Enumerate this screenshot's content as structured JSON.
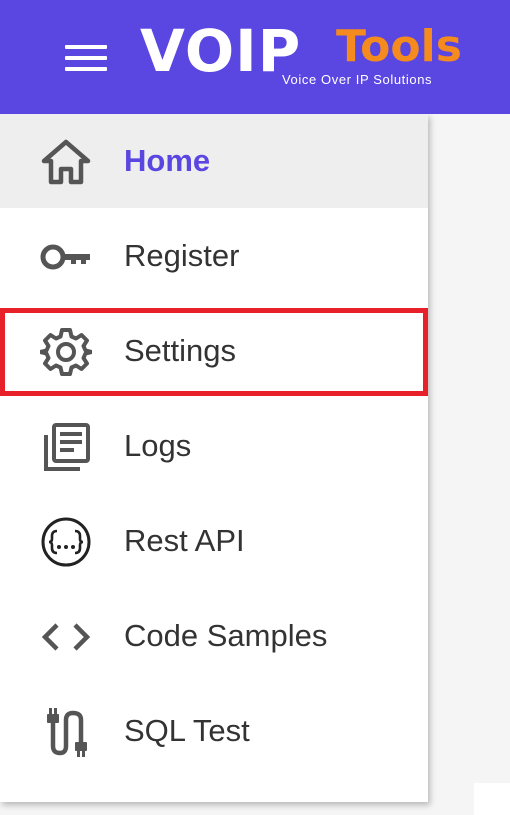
{
  "header": {
    "logo_brand": "VOIP",
    "logo_tools": "Tools",
    "logo_tagline": "Voice Over IP Solutions",
    "bar_color": "#5a46e0",
    "tools_color": "#f58b1f"
  },
  "nav": {
    "items": [
      {
        "label": "Home",
        "icon": "home-icon",
        "active": true
      },
      {
        "label": "Register",
        "icon": "key-icon",
        "active": false
      },
      {
        "label": "Settings",
        "icon": "gear-icon",
        "active": false
      },
      {
        "label": "Logs",
        "icon": "logs-icon",
        "active": false
      },
      {
        "label": "Rest API",
        "icon": "api-braces-icon",
        "active": false
      },
      {
        "label": "Code Samples",
        "icon": "code-icon",
        "active": false
      },
      {
        "label": "SQL Test",
        "icon": "plug-icon",
        "active": false
      }
    ],
    "active_color": "#5a46e0",
    "highlight_color": "#e8202a"
  }
}
